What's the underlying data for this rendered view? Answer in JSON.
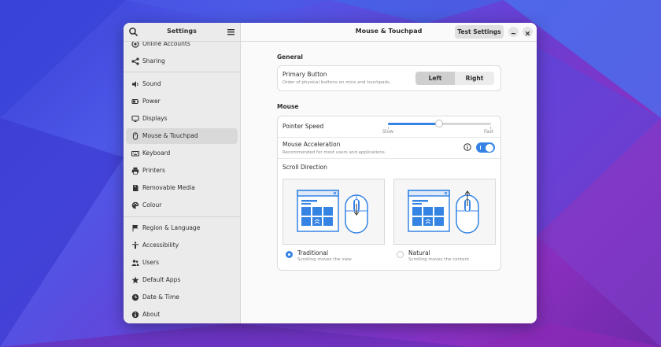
{
  "sidebar": {
    "title": "Settings",
    "items": [
      {
        "label": "Online Accounts",
        "icon": "at-icon"
      },
      {
        "label": "Sharing",
        "icon": "share-icon"
      },
      {
        "label": "Sound",
        "icon": "speaker-icon"
      },
      {
        "label": "Power",
        "icon": "power-icon"
      },
      {
        "label": "Displays",
        "icon": "display-icon"
      },
      {
        "label": "Mouse & Touchpad",
        "icon": "mouse-icon",
        "active": true
      },
      {
        "label": "Keyboard",
        "icon": "keyboard-icon"
      },
      {
        "label": "Printers",
        "icon": "printer-icon"
      },
      {
        "label": "Removable Media",
        "icon": "media-icon"
      },
      {
        "label": "Colour",
        "icon": "palette-icon"
      },
      {
        "label": "Region & Language",
        "icon": "flag-icon"
      },
      {
        "label": "Accessibility",
        "icon": "accessibility-icon"
      },
      {
        "label": "Users",
        "icon": "users-icon"
      },
      {
        "label": "Default Apps",
        "icon": "star-icon"
      },
      {
        "label": "Date & Time",
        "icon": "clock-icon"
      },
      {
        "label": "About",
        "icon": "info-icon"
      }
    ]
  },
  "header": {
    "title": "Mouse & Touchpad",
    "test_button": "Test Settings"
  },
  "general": {
    "section_title": "General",
    "primary_button": {
      "title": "Primary Button",
      "subtitle": "Order of physical buttons on mice and touchpads.",
      "options": [
        "Left",
        "Right"
      ],
      "selected": "Left"
    }
  },
  "mouse": {
    "section_title": "Mouse",
    "pointer_speed": {
      "title": "Pointer Speed",
      "min_label": "Slow",
      "max_label": "Fast",
      "value": 0.5
    },
    "acceleration": {
      "title": "Mouse Acceleration",
      "subtitle": "Recommended for most users and applications.",
      "enabled": true
    },
    "scroll_direction": {
      "title": "Scroll Direction",
      "options": [
        {
          "label": "Traditional",
          "subtitle": "Scrolling moves the view",
          "selected": true
        },
        {
          "label": "Natural",
          "subtitle": "Scrolling moves the content",
          "selected": false
        }
      ]
    }
  },
  "colors": {
    "accent": "#3584e4",
    "illustration": "#3584e4"
  }
}
